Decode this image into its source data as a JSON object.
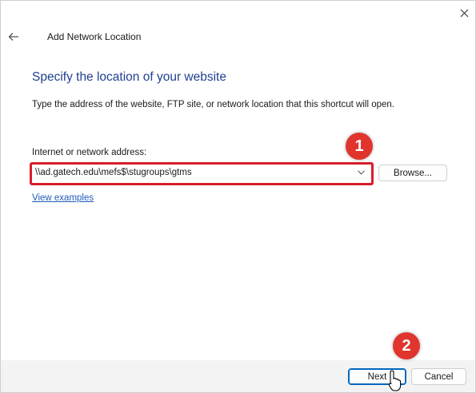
{
  "window": {
    "title": "Add Network Location",
    "close_icon": "close-icon",
    "back_icon": "arrow-left-icon"
  },
  "content": {
    "heading": "Specify the location of your website",
    "instruction": "Type the address of the website, FTP site, or network location that this shortcut will open.",
    "field_label": "Internet or network address:",
    "address_value": "\\\\ad.gatech.edu\\mefs$\\stugroups\\gtms",
    "browse_label": "Browse...",
    "examples_link": "View examples"
  },
  "footer": {
    "next_label": "Next",
    "cancel_label": "Cancel"
  },
  "annotations": {
    "step1": "1",
    "step2": "2",
    "color": "#e0352d"
  },
  "colors": {
    "heading": "#1f3f8f",
    "link": "#1e5bb8",
    "highlight": "#d81e2a",
    "primary_border": "#0067c0"
  }
}
